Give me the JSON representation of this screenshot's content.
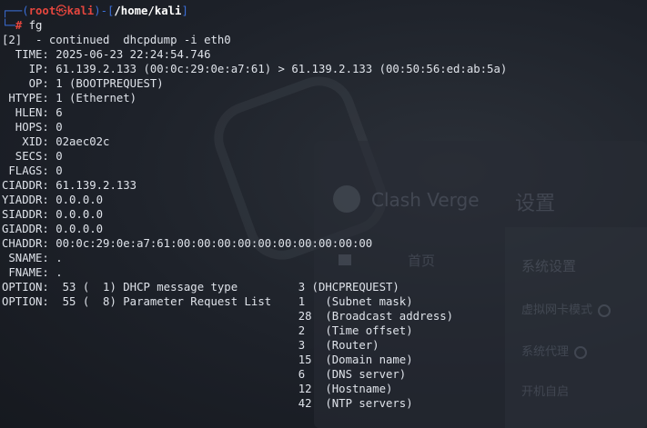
{
  "prompt": {
    "user": "root",
    "symbol": "㉿",
    "host": "kali",
    "cwd": "/home/kali",
    "marker": "#",
    "command": "fg"
  },
  "output_lines": [
    "[2]  - continued  dhcpdump -i eth0",
    "  TIME: 2025-06-23 22:24:54.746",
    "    IP: 61.139.2.133 (00:0c:29:0e:a7:61) > 61.139.2.133 (00:50:56:ed:ab:5a)",
    "    OP: 1 (BOOTPREQUEST)",
    " HTYPE: 1 (Ethernet)",
    "  HLEN: 6",
    "  HOPS: 0",
    "   XID: 02aec02c",
    "  SECS: 0",
    " FLAGS: 0",
    "CIADDR: 61.139.2.133",
    "YIADDR: 0.0.0.0",
    "SIADDR: 0.0.0.0",
    "GIADDR: 0.0.0.0",
    "CHADDR: 00:0c:29:0e:a7:61:00:00:00:00:00:00:00:00:00:00",
    " SNAME: .",
    " FNAME: .",
    "OPTION:  53 (  1) DHCP message type         3 (DHCPREQUEST)",
    "OPTION:  55 (  8) Parameter Request List    1   (Subnet mask)",
    "                                            28  (Broadcast address)",
    "                                            2   (Time offset)",
    "                                            3   (Router)",
    "                                            15  (Domain name)",
    "                                            6   (DNS server)",
    "                                            12  (Hostname)",
    "                                            42  (NTP servers)"
  ],
  "background": {
    "app_name": "Clash Verge",
    "settings_title": "设置",
    "nav_home": "首页",
    "section_title": "系统设置",
    "item_tun": "虚拟网卡模式",
    "item_proxy": "系统代理",
    "item_autostart": "开机自启"
  }
}
